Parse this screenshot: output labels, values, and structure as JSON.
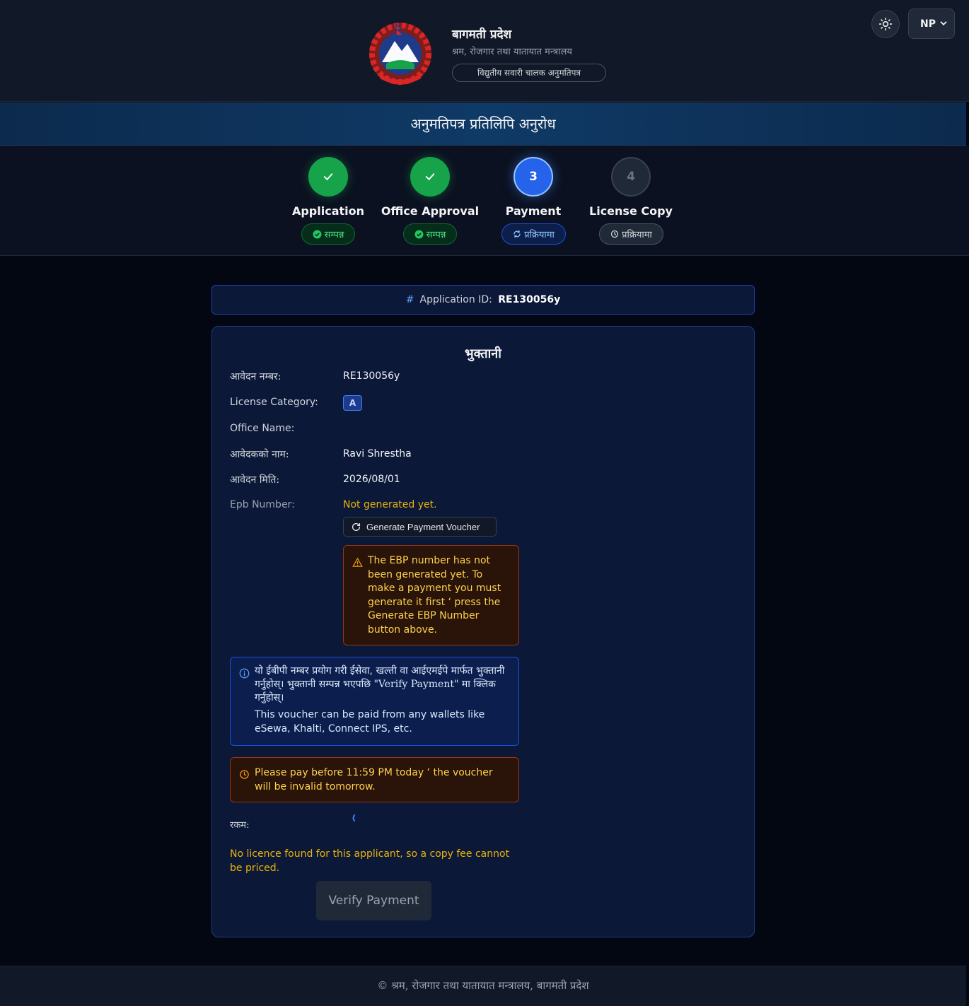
{
  "header": {
    "title": "बागमती प्रदेश",
    "subtitle": "श्रम, रोजगार तथा यातायात मन्त्रालय",
    "pill": "विद्युतीय सवारी चालक अनुमतिपत्र",
    "language": "NP"
  },
  "banner": {
    "title": "अनुमतिपत्र प्रतिलिपि अनुरोध"
  },
  "steps": [
    {
      "number": "1",
      "label": "Application",
      "status": "सम्पन्न",
      "state": "done"
    },
    {
      "number": "2",
      "label": "Office Approval",
      "status": "सम्पन्न",
      "state": "done"
    },
    {
      "number": "3",
      "label": "Payment",
      "status": "प्रक्रियामा",
      "state": "active"
    },
    {
      "number": "4",
      "label": "License Copy",
      "status": "प्रक्रियामा",
      "state": "pending"
    }
  ],
  "app_id_bar": {
    "hash": "#",
    "label": "Application ID:",
    "value": "RE130056y"
  },
  "payment": {
    "title": "भुक्तानी",
    "application_number_label": "आवेदन नम्बर:",
    "application_number": "RE130056y",
    "license_category_label": "License Category:",
    "license_category": "A",
    "office_name_label": "Office Name:",
    "office_name": "",
    "applicant_name_label": "आवेदकको नाम:",
    "applicant_name": "Ravi Shrestha",
    "application_date_label": "आवेदन मिति:",
    "application_date": "2026/08/01",
    "epb_label": "Epb Number:",
    "epb_value": "Not generated yet.",
    "generate_button": "Generate Payment Voucher",
    "ebp_warning": "The EBP number has not been generated yet. To make a payment you must generate it first ‘ press the Generate EBP Number button above.",
    "info_np": "यो ईबीपी नम्बर प्रयोग गरी ईसेवा, खल्ती वा आईएमईपे मार्फत भुक्तानी गर्नुहोस्। भुक्तानी सम्पन्न भएपछि \"Verify Payment\" मा क्लिक गर्नुहोस्।",
    "info_en": "This voucher can be paid from any wallets like eSewa, Khalti, Connect IPS, etc.",
    "time_warning": "Please pay before 11:59 PM today ‘ the voucher will be invalid tomorrow.",
    "amount_label": "रकम:",
    "no_licence": "No licence found for this applicant, so a copy fee cannot be priced.",
    "verify_button": "Verify Payment"
  },
  "footer": {
    "text": "© श्रम, रोजगार तथा यातायात मन्त्रालय, बागमती प्रदेश"
  },
  "colors": {
    "accent": "#2563eb",
    "success": "#16a34a",
    "warning": "#eab308",
    "background": "#030712"
  },
  "icons": {
    "theme": "sun-icon",
    "language_dropdown": "chevron-down-icon",
    "step_done": "check-icon",
    "generate": "refresh-icon",
    "ebp_alert": "warning-triangle-icon",
    "info": "info-circle-icon",
    "time": "clock-icon"
  }
}
